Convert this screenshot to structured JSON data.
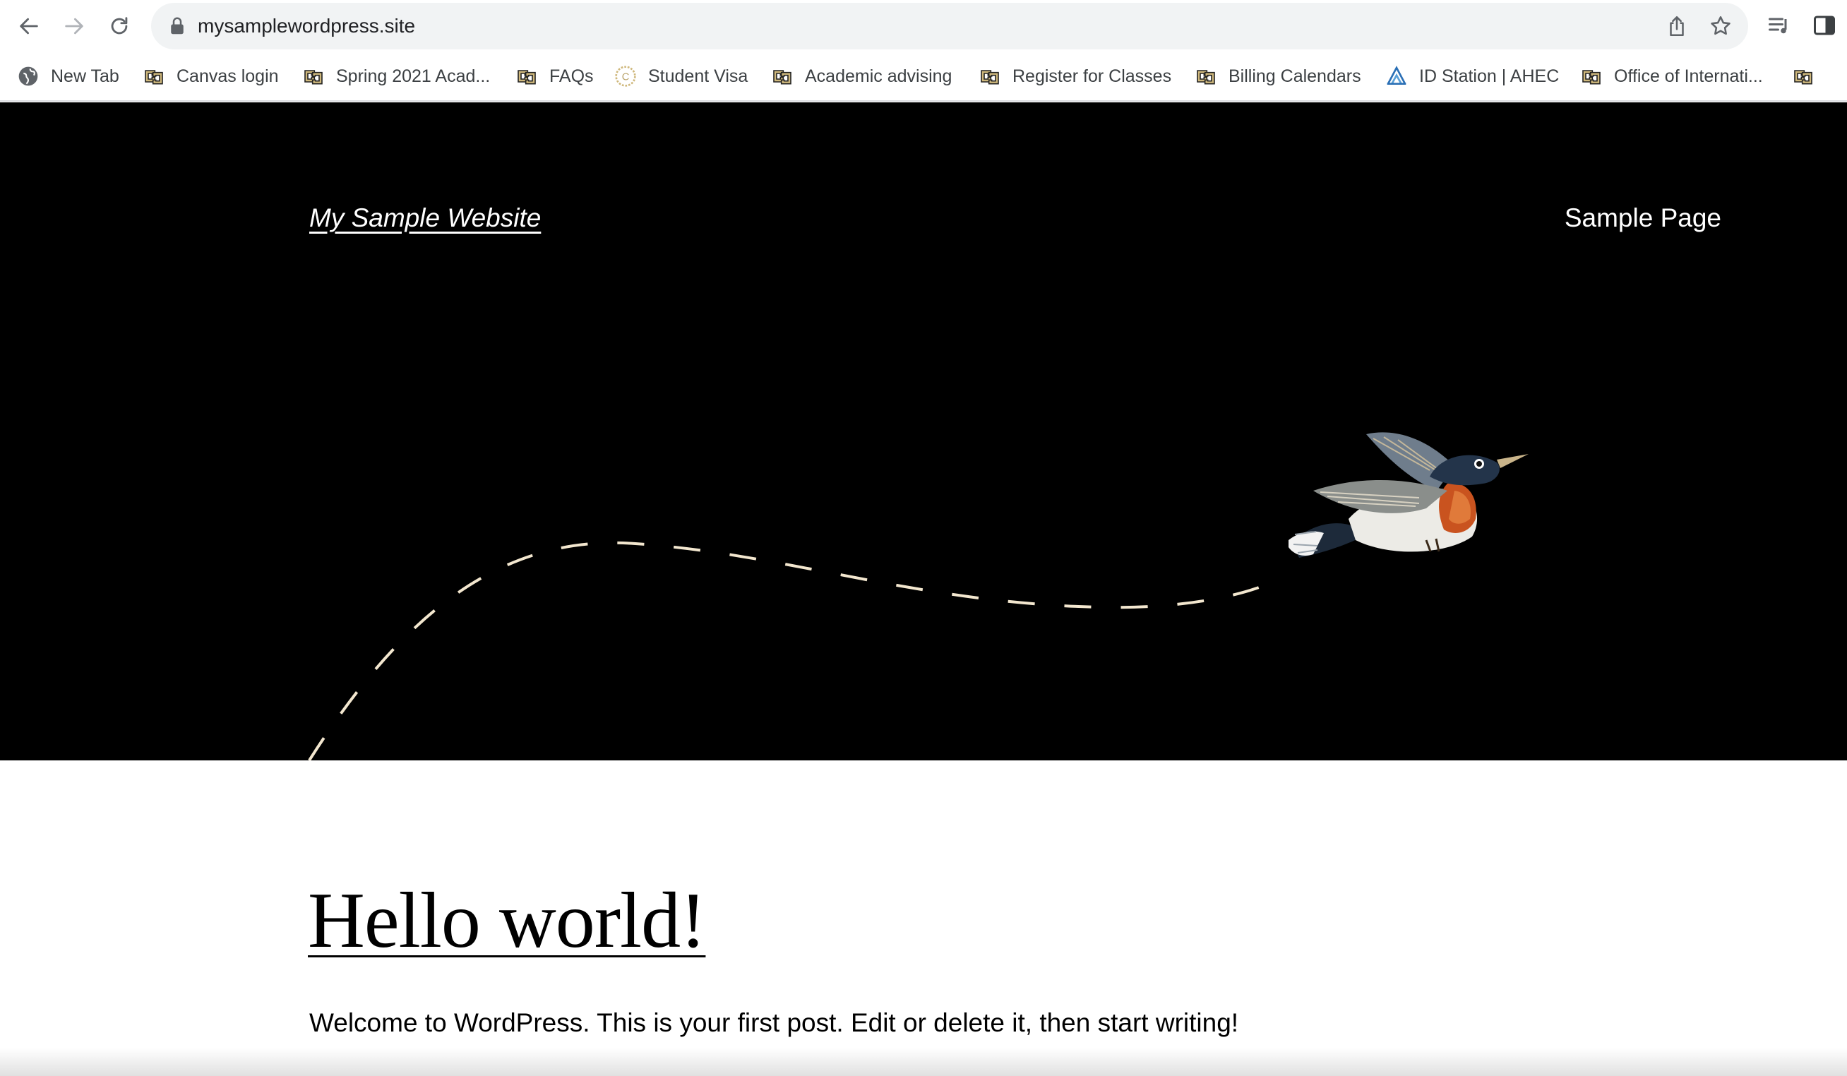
{
  "browser": {
    "url": "mysamplewordpress.site",
    "icons": {
      "back": "back-arrow-icon",
      "forward": "forward-arrow-icon",
      "reload": "reload-icon",
      "lock": "lock-icon",
      "share": "share-icon",
      "bookmark": "star-icon",
      "reading_list": "reading-list-icon",
      "side_panel": "side-panel-icon"
    },
    "bookmarks": [
      {
        "label": "New Tab",
        "icon": "globe-icon"
      },
      {
        "label": "Canvas login",
        "icon": "cu-logo-icon"
      },
      {
        "label": "Spring 2021 Acad...",
        "icon": "cu-logo-icon"
      },
      {
        "label": "FAQs",
        "icon": "cu-logo-icon"
      },
      {
        "label": "Student Visa",
        "icon": "seal-icon"
      },
      {
        "label": "Academic advising",
        "icon": "cu-logo-icon"
      },
      {
        "label": "Register for Classes",
        "icon": "cu-logo-icon"
      },
      {
        "label": "Billing Calendars",
        "icon": "cu-logo-icon"
      },
      {
        "label": "ID Station | AHEC",
        "icon": "ahec-logo-icon"
      },
      {
        "label": "Office of Internati...",
        "icon": "cu-logo-icon"
      },
      {
        "label": "",
        "icon": "cu-logo-icon"
      }
    ]
  },
  "site": {
    "title": "My Sample Website",
    "nav": [
      "Sample Page"
    ],
    "colors": {
      "header_bg": "#000000",
      "path_dash": "#f3e7cf",
      "text": "#ffffff"
    }
  },
  "post": {
    "title": "Hello world!",
    "excerpt": "Welcome to WordPress. This is your first post. Edit or delete it, then start writing!"
  }
}
